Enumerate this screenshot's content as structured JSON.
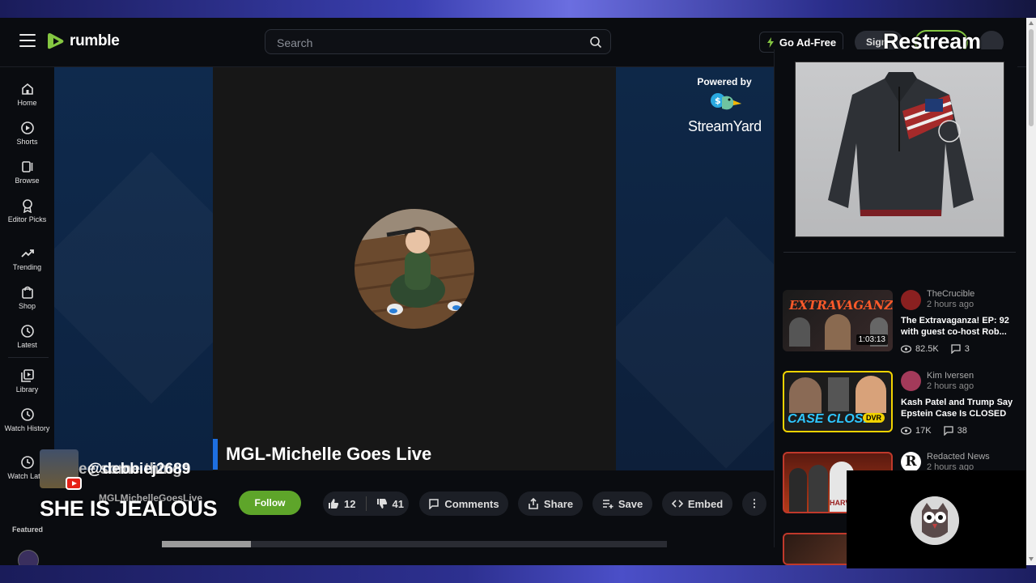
{
  "header": {
    "logo_text": "rumble",
    "search_placeholder": "Search",
    "go_ad_free": "Go Ad-Free",
    "sign_in": "Sign",
    "overlay_brand": "Restream"
  },
  "sidebar": {
    "items": [
      {
        "label": "Home",
        "icon": "home-icon"
      },
      {
        "label": "Shorts",
        "icon": "shorts-icon"
      },
      {
        "label": "Browse",
        "icon": "browse-icon"
      },
      {
        "label": "Editor Picks",
        "icon": "award-icon"
      },
      {
        "label": "Trending",
        "icon": "trending-icon"
      },
      {
        "label": "Shop",
        "icon": "shop-icon"
      },
      {
        "label": "Latest",
        "icon": "clock-icon"
      },
      {
        "label": "Library",
        "icon": "library-icon"
      },
      {
        "label": "Watch History",
        "icon": "history-icon"
      },
      {
        "label": "Watch Later",
        "icon": "watch-later-icon"
      }
    ],
    "featured_label": "Featured"
  },
  "video": {
    "powered_by": "Powered by",
    "streamyard": "StreamYard",
    "name_banner": "MGL-Michelle Goes Live"
  },
  "chat": {
    "username": "@debbiej2689",
    "message_fragment": "ee some things",
    "overlay_text": "SHE IS JEALOUS"
  },
  "channel": {
    "name": "MGLMichelleGoesLive",
    "follow": "Follow"
  },
  "actions": {
    "likes": "12",
    "dislikes": "41",
    "comments": "Comments",
    "share": "Share",
    "save": "Save",
    "embed": "Embed",
    "more": "⋮"
  },
  "recommended": [
    {
      "channel": "TheCrucible",
      "time": "2 hours ago",
      "title": "The Extravaganza! EP: 92 with guest co-host Rob...",
      "views": "82.5K",
      "comments": "3",
      "duration": "1:03:13",
      "thumb_text": "EXTRAVAGANZA"
    },
    {
      "channel": "Kim Iversen",
      "time": "2 hours ago",
      "title": "Kash Patel and Trump Say Epstein Case Is CLOSED",
      "views": "17K",
      "comments": "38",
      "badge": "DVR",
      "thumb_text": "CASE CLOSED"
    },
    {
      "channel": "Redacted News",
      "time": "2 hours ago",
      "thumb_text": "HARVA"
    }
  ],
  "colors": {
    "accent_green": "#85c742",
    "follow_green": "#5ea52a",
    "banner_blue": "#1e6fe0"
  }
}
